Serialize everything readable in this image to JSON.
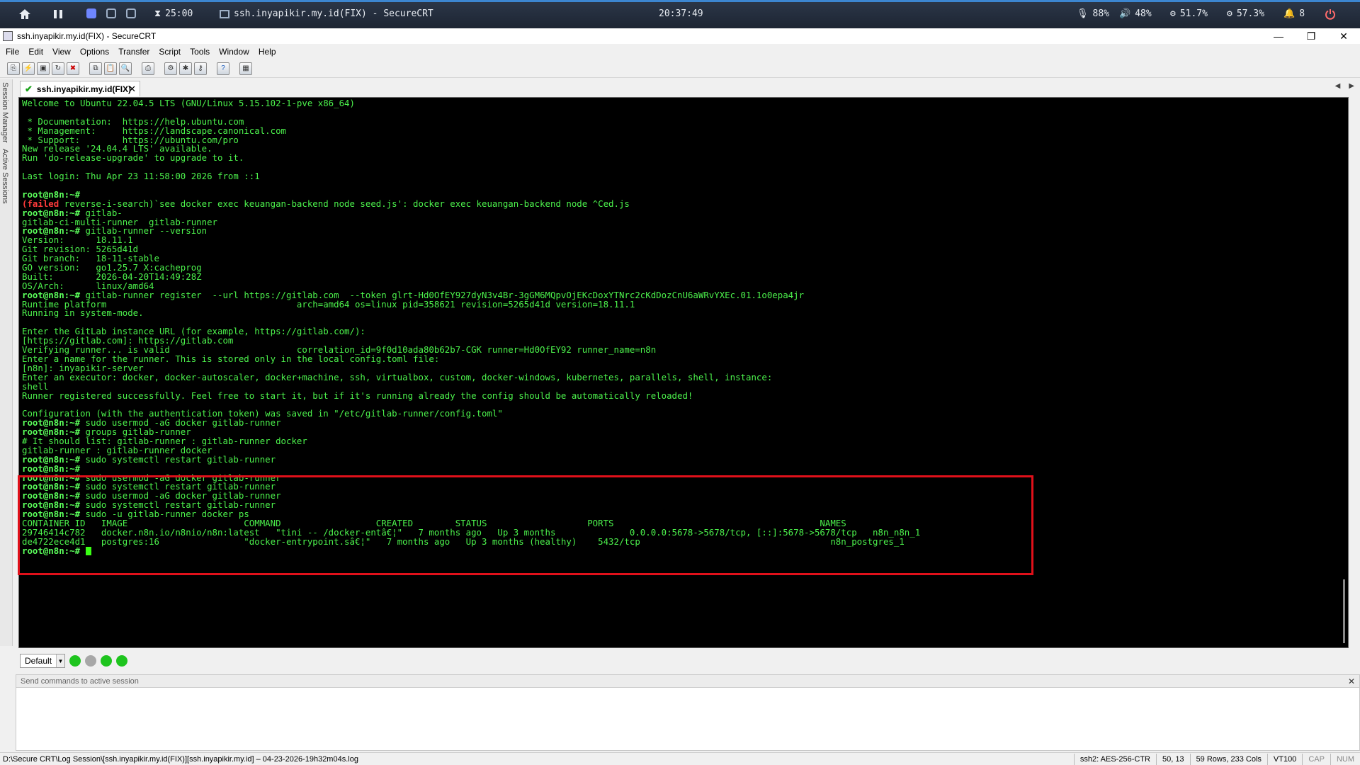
{
  "system_bar": {
    "timer": "25:00",
    "window_title": "ssh.inyapikir.my.id(FIX) - SecureCRT",
    "clock": "20:37:49",
    "mic": "88%",
    "volume": "48%",
    "cpu": "51.7%",
    "mem": "57.3%",
    "notifications": "8"
  },
  "window": {
    "title": "ssh.inyapikir.my.id(FIX) - SecureCRT"
  },
  "menu": [
    "File",
    "Edit",
    "View",
    "Options",
    "Transfer",
    "Script",
    "Tools",
    "Window",
    "Help"
  ],
  "side_tabs": [
    "Session Manager",
    "Active Sessions"
  ],
  "tab": {
    "label": "ssh.inyapikir.my.id(FIX)"
  },
  "terminal": {
    "lines": [
      "Welcome to Ubuntu 22.04.5 LTS (GNU/Linux 5.15.102-1-pve x86_64)",
      "",
      " * Documentation:  https://help.ubuntu.com",
      " * Management:     https://landscape.canonical.com",
      " * Support:        https://ubuntu.com/pro",
      "New release '24.04.4 LTS' available.",
      "Run 'do-release-upgrade' to upgrade to it.",
      "",
      "Last login: Thu Apr 23 11:58:00 2026 from ::1",
      "",
      "root@n8n:~#",
      "(failed reverse-i-search)`see docker exec keuangan-backend node seed.js': docker exec keuangan-backend node ^Ced.js",
      "root@n8n:~# gitlab-",
      "gitlab-ci-multi-runner  gitlab-runner",
      "root@n8n:~# gitlab-runner --version",
      "Version:      18.11.1",
      "Git revision: 5265d41d",
      "Git branch:   18-11-stable",
      "GO version:   go1.25.7 X:cacheprog",
      "Built:        2026-04-20T14:49:28Z",
      "OS/Arch:      linux/amd64",
      "root@n8n:~# gitlab-runner register  --url https://gitlab.com  --token glrt-Hd0OfEY927dyN3v4Br-3gGM6MQpvOjEKcDoxYTNrc2cKdDozCnU6aWRvYXEc.01.1o0epa4jr",
      "Runtime platform                                    arch=amd64 os=linux pid=358621 revision=5265d41d version=18.11.1",
      "Running in system-mode.",
      "",
      "Enter the GitLab instance URL (for example, https://gitlab.com/):",
      "[https://gitlab.com]: https://gitlab.com",
      "Verifying runner... is valid                        correlation_id=9f0d10ada80b62b7-CGK runner=Hd0OfEY92 runner_name=n8n",
      "Enter a name for the runner. This is stored only in the local config.toml file:",
      "[n8n]: inyapikir-server",
      "Enter an executor: docker, docker-autoscaler, docker+machine, ssh, virtualbox, custom, docker-windows, kubernetes, parallels, shell, instance:",
      "shell",
      "Runner registered successfully. Feel free to start it, but if it's running already the config should be automatically reloaded!",
      "",
      "Configuration (with the authentication token) was saved in \"/etc/gitlab-runner/config.toml\"",
      "root@n8n:~# sudo usermod -aG docker gitlab-runner",
      "root@n8n:~# groups gitlab-runner",
      "# It should list: gitlab-runner : gitlab-runner docker",
      "gitlab-runner : gitlab-runner docker",
      "root@n8n:~# sudo systemctl restart gitlab-runner",
      "root@n8n:~#",
      "root@n8n:~# sudo usermod -aG docker gitlab-runner",
      "root@n8n:~# sudo systemctl restart gitlab-runner",
      "root@n8n:~# sudo usermod -aG docker gitlab-runner",
      "root@n8n:~# sudo systemctl restart gitlab-runner",
      "root@n8n:~# sudo -u gitlab-runner docker ps",
      "CONTAINER ID   IMAGE                      COMMAND                  CREATED        STATUS                   PORTS                                       NAMES",
      "29746414c782   docker.n8n.io/n8nio/n8n:latest   \"tini -- /docker-entâ€¦\"   7 months ago   Up 3 months              0.0.0.0:5678->5678/tcp, [::]:5678->5678/tcp   n8n_n8n_1",
      "de4722ece4d1   postgres:16                \"docker-entrypoint.sâ€¦\"   7 months ago   Up 3 months (healthy)    5432/tcp                                    n8n_postgres_1",
      "root@n8n:~# "
    ]
  },
  "button_bar": {
    "combo": "Default"
  },
  "command_window": {
    "header": "Send commands to active session"
  },
  "status_bar": {
    "log_path": "D:\\Secure CRT\\Log Session\\[ssh.inyapikir.my.id(FIX)][ssh.inyapikir.my.id] – 04-23-2026-19h32m04s.log",
    "cipher": "ssh2: AES-256-CTR",
    "position": "50, 13",
    "size": "59 Rows, 233 Cols",
    "term": "VT100",
    "caps": "CAP",
    "num": "NUM"
  },
  "colors": {
    "terminal_fg": "#4cf24c",
    "terminal_bg": "#000000",
    "highlight_box": "#e0101a",
    "error_red": "#ff3b3b",
    "cyan": "#4fd4ff"
  }
}
